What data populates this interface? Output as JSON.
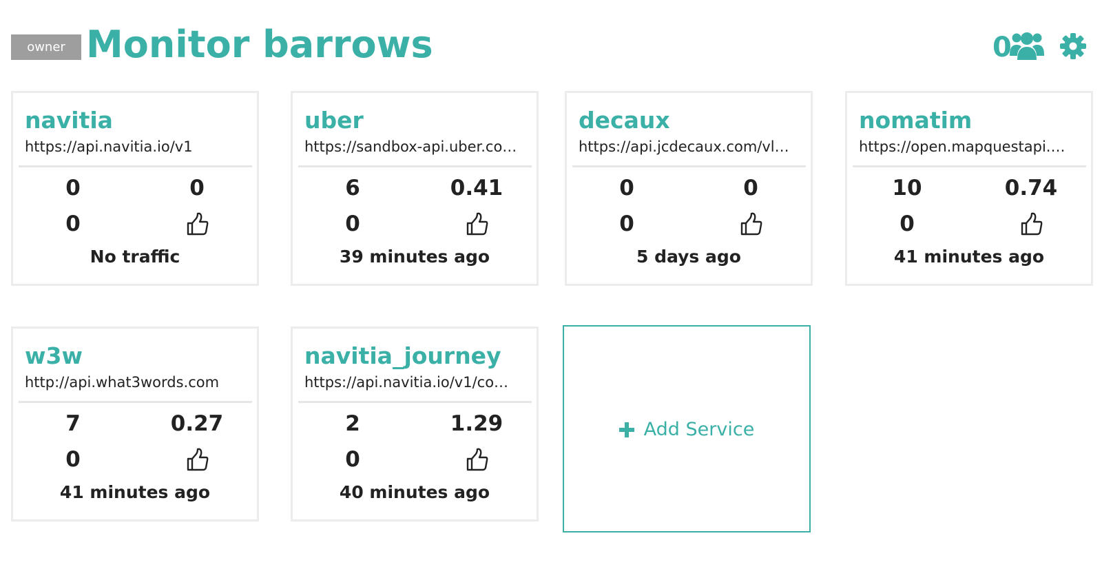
{
  "header": {
    "role_badge": "owner",
    "title": "Monitor barrows",
    "user_count": "0",
    "icons": [
      "users-icon",
      "gear-icon"
    ]
  },
  "accent_color": "#3ab0a7",
  "services": [
    {
      "name": "navitia",
      "url": "https://api.navitia.io/v1",
      "stat_top_left": "0",
      "stat_top_right": "0",
      "stat_bottom_left": "0",
      "status_icon": "thumbs-up-icon",
      "last_activity": "No traffic"
    },
    {
      "name": "uber",
      "url": "https://sandbox-api.uber.co…",
      "stat_top_left": "6",
      "stat_top_right": "0.41",
      "stat_bottom_left": "0",
      "status_icon": "thumbs-up-icon",
      "last_activity": "39 minutes ago"
    },
    {
      "name": "decaux",
      "url": "https://api.jcdecaux.com/vl…",
      "stat_top_left": "0",
      "stat_top_right": "0",
      "stat_bottom_left": "0",
      "status_icon": "thumbs-up-icon",
      "last_activity": "5 days ago"
    },
    {
      "name": "nomatim",
      "url": "https://open.mapquestapi.…",
      "stat_top_left": "10",
      "stat_top_right": "0.74",
      "stat_bottom_left": "0",
      "status_icon": "thumbs-up-icon",
      "last_activity": "41 minutes ago"
    },
    {
      "name": "w3w",
      "url": "http://api.what3words.com",
      "stat_top_left": "7",
      "stat_top_right": "0.27",
      "stat_bottom_left": "0",
      "status_icon": "thumbs-up-icon",
      "last_activity": "41 minutes ago"
    },
    {
      "name": "navitia_journey",
      "url": "https://api.navitia.io/v1/co…",
      "stat_top_left": "2",
      "stat_top_right": "1.29",
      "stat_bottom_left": "0",
      "status_icon": "thumbs-up-icon",
      "last_activity": "40 minutes ago"
    }
  ],
  "add_service": {
    "label": "Add Service",
    "icon": "plus-icon"
  }
}
